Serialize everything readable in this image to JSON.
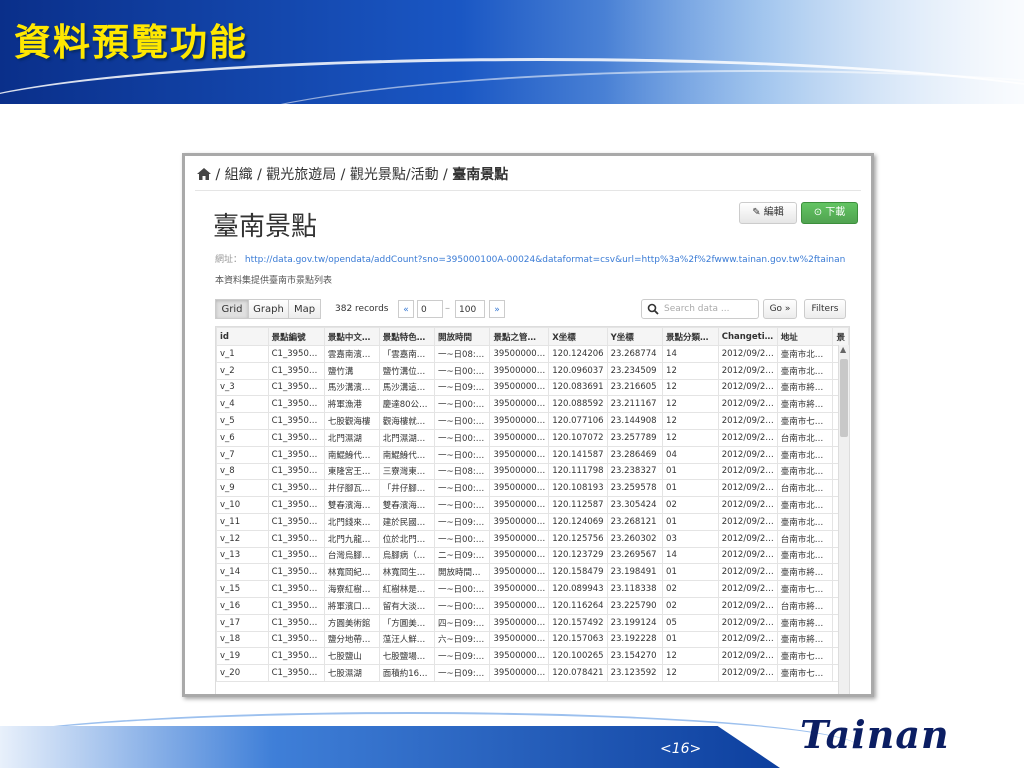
{
  "slide": {
    "title": "資料預覽功能",
    "page": "<16>",
    "brand": "Tainan"
  },
  "breadcrumb": {
    "path": "/ 組織 / 觀光旅遊局 / 觀光景點/活動 / ",
    "current": "臺南景點"
  },
  "dataset": {
    "title": "臺南景點",
    "edit_label": "編輯",
    "download_label": "下載",
    "url_label": "網址：",
    "url": "http://data.gov.tw/opendata/addCount?sno=395000100A-00024&dataformat=csv&url=http%3a%2f%2fwww.tainan.gov.tw%2ftainan...",
    "description": "本資料集提供臺南市景點列表"
  },
  "toolbar": {
    "views": [
      "Grid",
      "Graph",
      "Map"
    ],
    "active_view": "Grid",
    "records": "382 records",
    "prev": "«",
    "from": "0",
    "dash": "–",
    "to": "100",
    "next": "»",
    "search_placeholder": "Search data ...",
    "go_label": "Go »",
    "filters_label": "Filters"
  },
  "grid": {
    "columns": [
      "id",
      "景點編號",
      "景點中文…",
      "景點特色…",
      "開放時間",
      "景點之管…",
      "X坐標",
      "Y坐標",
      "景點分類…",
      "Changeti…",
      "地址",
      "景"
    ],
    "rows": [
      [
        "v_1",
        "C1_3950…",
        "雲嘉南濱…",
        "「雲嘉南…",
        "一~日08:…",
        "39500000…",
        "120.124206",
        "23.268774",
        "14",
        "2012/09/2…",
        "臺南市北…",
        ""
      ],
      [
        "v_2",
        "C1_3950…",
        "鹽竹溝",
        "鹽竹溝位…",
        "一~日00:…",
        "39500000…",
        "120.096037",
        "23.234509",
        "12",
        "2012/09/2…",
        "臺南市北…",
        ""
      ],
      [
        "v_3",
        "C1_3950…",
        "馬沙溝濱…",
        "馬沙溝這…",
        "一~日09:…",
        "39500000…",
        "120.083691",
        "23.216605",
        "12",
        "2012/09/2…",
        "臺南市將…",
        ""
      ],
      [
        "v_4",
        "C1_3950…",
        "將軍漁港",
        "慶達80公…",
        "一~日00:…",
        "39500000…",
        "120.088592",
        "23.211167",
        "12",
        "2012/09/2…",
        "臺南市將…",
        ""
      ],
      [
        "v_5",
        "C1_3950…",
        "七股觀海樓",
        "觀海樓就…",
        "一~日00:…",
        "39500000…",
        "120.077106",
        "23.144908",
        "12",
        "2012/09/2…",
        "臺南市七…",
        ""
      ],
      [
        "v_6",
        "C1_3950…",
        "北門濕湖",
        "北門濕湖…",
        "一~日00:…",
        "39500000…",
        "120.107072",
        "23.257789",
        "12",
        "2012/09/2…",
        "台南市北…",
        ""
      ],
      [
        "v_7",
        "C1_3950…",
        "南鯤鯓代…",
        "南鯤鯓代…",
        "一~日00:…",
        "39500000…",
        "120.141587",
        "23.286469",
        "04",
        "2012/09/2…",
        "臺南市北…",
        ""
      ],
      [
        "v_8",
        "C1_3950…",
        "東隆宮王…",
        "三寮灣東…",
        "一~日08:…",
        "39500000…",
        "120.111798",
        "23.238327",
        "01",
        "2012/09/2…",
        "臺南市北…",
        ""
      ],
      [
        "v_9",
        "C1_3950…",
        "井仔腳瓦…",
        "「井仔腳…",
        "一~日00:…",
        "39500000…",
        "120.108193",
        "23.259578",
        "01",
        "2012/09/2…",
        "台南市北…",
        ""
      ],
      [
        "v_10",
        "C1_3950…",
        "雙春濱海…",
        "雙春濱海…",
        "一~日00:…",
        "39500000…",
        "120.112587",
        "23.305424",
        "02",
        "2012/09/2…",
        "臺南市北…",
        ""
      ],
      [
        "v_11",
        "C1_3950…",
        "北門錢來…",
        "建於民國…",
        "一~日09:…",
        "39500000…",
        "120.124069",
        "23.268121",
        "01",
        "2012/09/2…",
        "臺南市北…",
        ""
      ],
      [
        "v_12",
        "C1_3950…",
        "北門九龍…",
        "位於北門…",
        "一~日00:…",
        "39500000…",
        "120.125756",
        "23.260302",
        "03",
        "2012/09/2…",
        "台南市北…",
        ""
      ],
      [
        "v_13",
        "C1_3950…",
        "台灣烏腳…",
        "烏腳病（…",
        "二~日09:…",
        "39500000…",
        "120.123729",
        "23.269567",
        "14",
        "2012/09/2…",
        "臺南市北…",
        ""
      ],
      [
        "v_14",
        "C1_3950…",
        "林寬岡紀…",
        "林寬岡生…",
        "開放時間…",
        "39500000…",
        "120.158479",
        "23.198491",
        "01",
        "2012/09/2…",
        "臺南市將…",
        ""
      ],
      [
        "v_15",
        "C1_3950…",
        "海寮紅樹…",
        "紅樹林是…",
        "一~日00:…",
        "39500000…",
        "120.089943",
        "23.118338",
        "02",
        "2012/09/2…",
        "臺南市七…",
        ""
      ],
      [
        "v_16",
        "C1_3950…",
        "將軍濱口…",
        "留有大淡…",
        "一~日00:…",
        "39500000…",
        "120.116264",
        "23.225790",
        "02",
        "2012/09/2…",
        "台南市將…",
        ""
      ],
      [
        "v_17",
        "C1_3950…",
        "方圓美術館",
        "「方圓美…",
        "四~日09:…",
        "39500000…",
        "120.157492",
        "23.199124",
        "05",
        "2012/09/2…",
        "臺南市將…",
        ""
      ],
      [
        "v_18",
        "C1_3950…",
        "鹽分地帶…",
        "蕰汪人鮮…",
        "六~日09:…",
        "39500000…",
        "120.157063",
        "23.192228",
        "01",
        "2012/09/2…",
        "臺南市將…",
        ""
      ],
      [
        "v_19",
        "C1_3950…",
        "七股鹽山",
        "七股鹽場…",
        "一~日09:…",
        "39500000…",
        "120.100265",
        "23.154270",
        "12",
        "2012/09/2…",
        "臺南市七…",
        ""
      ],
      [
        "v_20",
        "C1_3950…",
        "七股濕湖",
        "面積約16…",
        "一~日09:…",
        "39500000…",
        "120.078421",
        "23.123592",
        "12",
        "2012/09/2…",
        "臺南市七…",
        ""
      ]
    ]
  }
}
